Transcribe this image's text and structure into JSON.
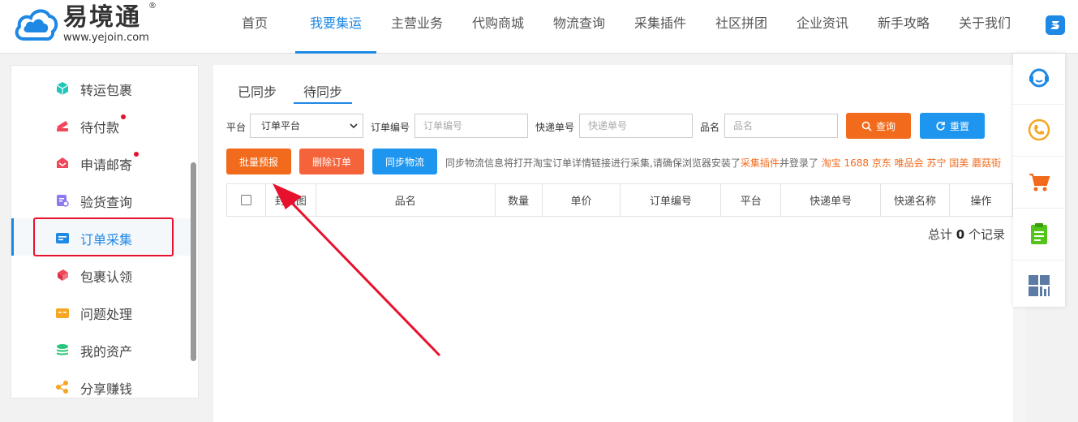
{
  "brand": {
    "name": "易境通",
    "reg": "®",
    "url": "www.yejoin.com",
    "color": "#1e88e5"
  },
  "nav": {
    "items": [
      "首页",
      "我要集运",
      "主营业务",
      "代购商城",
      "物流查询",
      "采集插件",
      "社区拼团",
      "企业资讯",
      "新手攻略",
      "关于我们"
    ],
    "active": "我要集运"
  },
  "sidebar": {
    "items": [
      {
        "label": "转运包裹",
        "icon": "cube-icon",
        "color": "#1fc7b8"
      },
      {
        "label": "待付款",
        "icon": "payment-icon",
        "color": "#f0485a",
        "dot": true
      },
      {
        "label": "申请邮寄",
        "icon": "mail-gift-icon",
        "color": "#f0485a",
        "dot": true
      },
      {
        "label": "验货查询",
        "icon": "inspection-icon",
        "color": "#8c7bf0"
      },
      {
        "label": "订单采集",
        "icon": "order-collect-icon",
        "color": "#1e88e5",
        "active": true
      },
      {
        "label": "包裹认领",
        "icon": "package-claim-icon",
        "color": "#f0485a"
      },
      {
        "label": "问题处理",
        "icon": "issue-icon",
        "color": "#f5a623"
      },
      {
        "label": "我的资产",
        "icon": "asset-icon",
        "color": "#29c47a"
      },
      {
        "label": "分享赚钱",
        "icon": "share-icon",
        "color": "#f5a623"
      }
    ]
  },
  "tabs": [
    {
      "label": "已同步",
      "active": false
    },
    {
      "label": "待同步",
      "active": true
    }
  ],
  "filters": {
    "platform_label": "平台",
    "platform_value": "订单平台",
    "order_no_label": "订单编号",
    "order_no_placeholder": "订单编号",
    "tracking_label": "快递单号",
    "tracking_placeholder": "快递单号",
    "item_label": "品名",
    "item_placeholder": "品名",
    "search_button": "查询",
    "reset_button": "重置"
  },
  "actions": {
    "batch_declare": "批量预报",
    "delete_order": "删除订单",
    "sync_logistics": "同步物流"
  },
  "notice": {
    "text": "同步物流信息将打开淘宝订单详情链接进行采集,请确保浏览器安装了",
    "plugin_link": "采集插件",
    "mid": "并登录了",
    "platforms": "淘宝 1688 京东 唯品会 苏宁 国美 蘑菇街"
  },
  "table": {
    "columns": [
      "",
      "封面图",
      "品名",
      "数量",
      "单价",
      "订单编号",
      "平台",
      "快递单号",
      "快递名称",
      "操作"
    ]
  },
  "total": {
    "prefix": "总计",
    "count": "0",
    "suffix": "个记录"
  },
  "float_bar": {
    "items": [
      "customer-service-icon",
      "phone-icon",
      "cart-icon",
      "clipboard-icon",
      "qrcode-icon"
    ]
  },
  "colors": {
    "orange": "#f26b1d",
    "blue": "#1e88e5",
    "red_annotation": "#e8112d"
  }
}
